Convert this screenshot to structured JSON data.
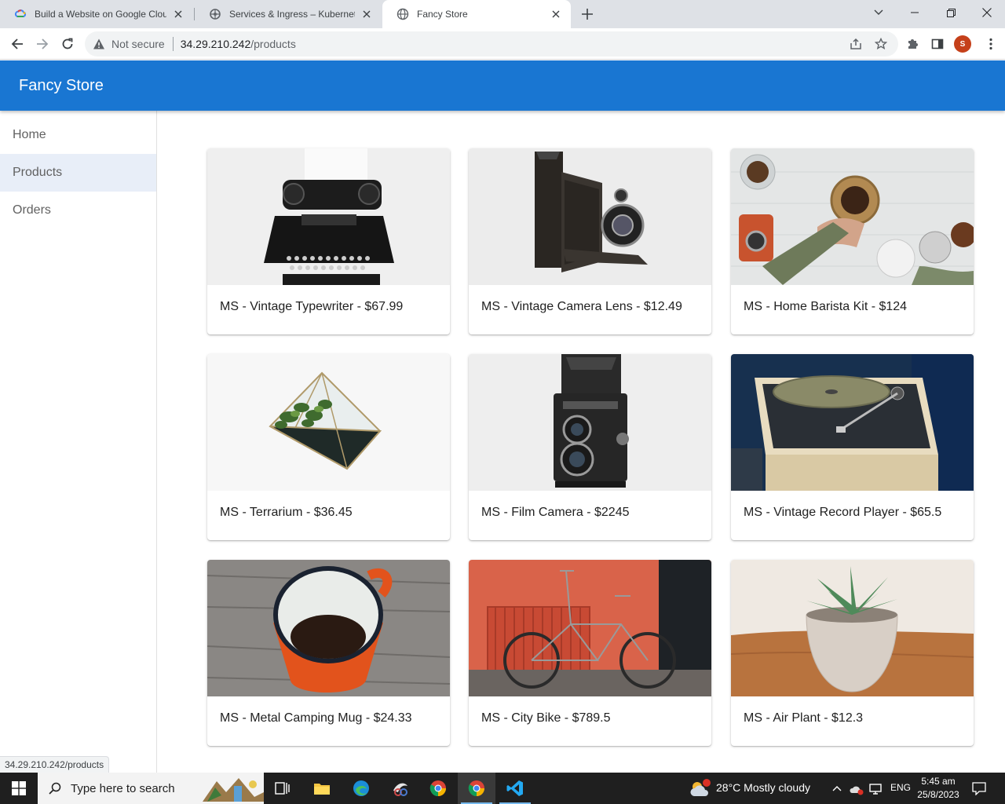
{
  "browser": {
    "tabs": [
      {
        "title": "Build a Website on Google Cloud",
        "favicon": "google-cloud-icon"
      },
      {
        "title": "Services & Ingress – Kubernetes E",
        "favicon": "kubernetes-icon"
      },
      {
        "title": "Fancy Store",
        "favicon": "globe-icon",
        "active": true
      }
    ],
    "security_label": "Not secure",
    "url_host": "34.29.210.242",
    "url_path": "/products",
    "profile_initial": "S"
  },
  "app": {
    "brand": "Fancy Store",
    "accent": "#1976d2",
    "nav": [
      {
        "label": "Home"
      },
      {
        "label": "Products",
        "active": true
      },
      {
        "label": "Orders"
      }
    ]
  },
  "products": [
    {
      "title": "MS - Vintage Typewriter - $67.99"
    },
    {
      "title": "MS - Vintage Camera Lens - $12.49"
    },
    {
      "title": "MS - Home Barista Kit - $124"
    },
    {
      "title": "MS - Terrarium - $36.45"
    },
    {
      "title": "MS - Film Camera - $2245"
    },
    {
      "title": "MS - Vintage Record Player - $65.5"
    },
    {
      "title": "MS - Metal Camping Mug - $24.33"
    },
    {
      "title": "MS - City Bike - $789.5"
    },
    {
      "title": "MS - Air Plant - $12.3"
    }
  ],
  "status_url": "34.29.210.242/products",
  "taskbar": {
    "search_placeholder": "Type here to search",
    "weather": "28°C  Mostly cloudy",
    "language": "ENG",
    "time": "5:45 am",
    "date": "25/8/2023"
  }
}
